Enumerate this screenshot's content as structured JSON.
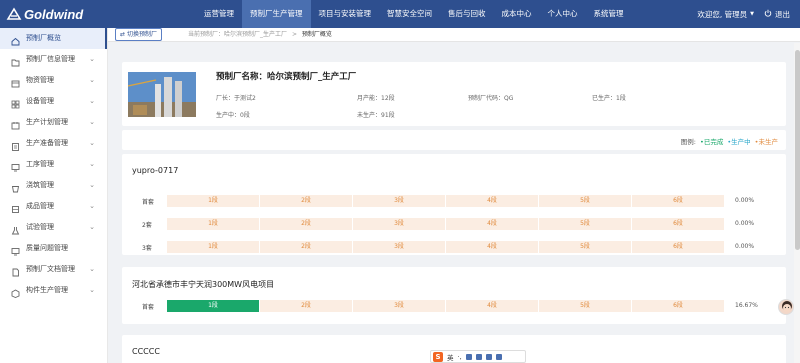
{
  "brand": {
    "name": "Goldwind"
  },
  "nav": {
    "items": [
      {
        "label": "运营管理",
        "active": false
      },
      {
        "label": "预制厂生产管理",
        "active": true
      },
      {
        "label": "项目与安装管理",
        "active": false
      },
      {
        "label": "智慧安全空间",
        "active": false
      },
      {
        "label": "售后与回收",
        "active": false
      },
      {
        "label": "成本中心",
        "active": false
      },
      {
        "label": "个人中心",
        "active": false
      },
      {
        "label": "系统管理",
        "active": false
      }
    ]
  },
  "user": {
    "greeting": "欢迎您, 管理员",
    "logout": "退出"
  },
  "sidebar": {
    "items": [
      {
        "label": "预制厂概览",
        "icon": "home-icon",
        "active": true,
        "expandable": false
      },
      {
        "label": "预制厂信息管理",
        "icon": "folder-icon",
        "active": false,
        "expandable": true
      },
      {
        "label": "物资管理",
        "icon": "box-icon",
        "active": false,
        "expandable": true
      },
      {
        "label": "设备管理",
        "icon": "grid-icon",
        "active": false,
        "expandable": true
      },
      {
        "label": "生产计划管理",
        "icon": "calendar-icon",
        "active": false,
        "expandable": true
      },
      {
        "label": "生产准备管理",
        "icon": "clipboard-icon",
        "active": false,
        "expandable": true
      },
      {
        "label": "工序管理",
        "icon": "monitor-icon",
        "active": false,
        "expandable": true
      },
      {
        "label": "浇筑管理",
        "icon": "bucket-icon",
        "active": false,
        "expandable": true
      },
      {
        "label": "成品管理",
        "icon": "product-icon",
        "active": false,
        "expandable": true
      },
      {
        "label": "试验管理",
        "icon": "flask-icon",
        "active": false,
        "expandable": true
      },
      {
        "label": "质量问题管理",
        "icon": "monitor-icon",
        "active": false,
        "expandable": false
      },
      {
        "label": "预制厂文档管理",
        "icon": "document-icon",
        "active": false,
        "expandable": true
      },
      {
        "label": "构件生产管理",
        "icon": "cube-icon",
        "active": false,
        "expandable": true
      }
    ]
  },
  "toolbar": {
    "switch_label": "切换预制厂"
  },
  "breadcrumb": {
    "items": [
      "当前预制厂：哈尔滨预制厂_生产工厂",
      "预制厂概览"
    ],
    "separator": ">"
  },
  "factory": {
    "name_line": "预制厂名称：哈尔滨预制厂_生产工厂",
    "fields": {
      "manager": "厂长：于测试2",
      "monthly_capacity": "月产能：12段",
      "code": "预制厂代码：QG",
      "produced": "已生产：1段",
      "in_production": "生产中：0段",
      "not_produced": "未生产：91段"
    }
  },
  "legend": {
    "title": "图例:",
    "items": [
      {
        "label": "已完成",
        "color": "#1aa86b"
      },
      {
        "label": "生产中",
        "color": "#26a6c9"
      },
      {
        "label": "未生产",
        "color": "#e08a3c"
      }
    ]
  },
  "projects": [
    {
      "title": "yupro-0717",
      "rows": [
        {
          "label": "首套",
          "segments": [
            "1段",
            "2段",
            "3段",
            "4段",
            "5段",
            "6段"
          ],
          "done": 0,
          "percent": "0.00%"
        },
        {
          "label": "2套",
          "segments": [
            "1段",
            "2段",
            "3段",
            "4段",
            "5段",
            "6段"
          ],
          "done": 0,
          "percent": "0.00%"
        },
        {
          "label": "3套",
          "segments": [
            "1段",
            "2段",
            "3段",
            "4段",
            "5段",
            "6段"
          ],
          "done": 0,
          "percent": "0.00%"
        }
      ]
    },
    {
      "title": "河北省承德市丰宁天润300MW风电项目",
      "rows": [
        {
          "label": "首套",
          "segments": [
            "1段",
            "2段",
            "3段",
            "4段",
            "5段",
            "6段"
          ],
          "done": 1,
          "percent": "16.67%"
        }
      ]
    },
    {
      "title": "CCCCC",
      "rows": []
    }
  ],
  "ime": {
    "logo": "S",
    "lang": "英"
  }
}
